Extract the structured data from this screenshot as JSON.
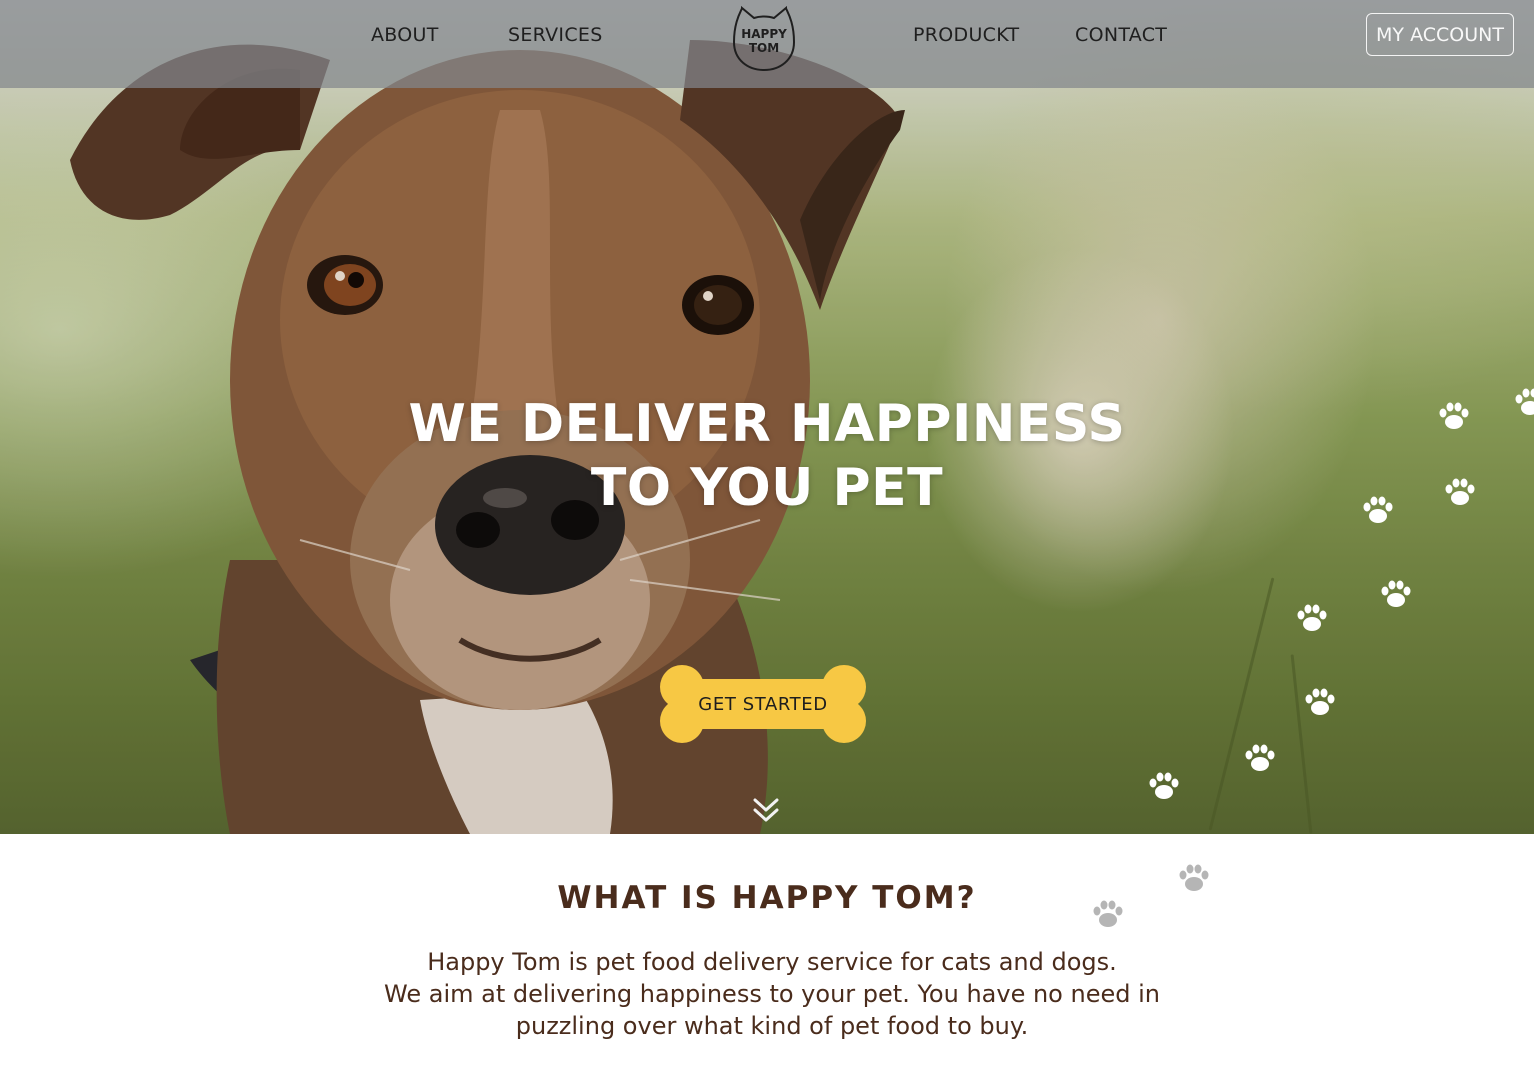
{
  "nav": {
    "links": [
      "ABOUT",
      "SERVICES",
      "PRODUCKT",
      "CONTACT"
    ],
    "logo_line1": "HAPPY",
    "logo_line2": "TOM",
    "account_label": "MY ACCOUNT"
  },
  "hero": {
    "headline_line1": "WE DELIVER HAPPINESS",
    "headline_line2": "TO YOU PET",
    "cta_label": "GET STARTED",
    "scroll_icon": "double-chevron-down-icon",
    "paw_icon": "paw-print-icon"
  },
  "about": {
    "title": "WHAT IS HAPPY TOM?",
    "lines": [
      "Happy Tom is pet food delivery service for cats and dogs.",
      "We aim at delivering happiness to your pet. You have no need in",
      "puzzling over what kind of pet food to buy."
    ]
  },
  "colors": {
    "cta_yellow": "#f7c844",
    "brand_brown": "#4a2c1c",
    "nav_overlay": "#82878c",
    "paw_gray": "#b5b5b5",
    "paw_white": "#ffffff"
  }
}
